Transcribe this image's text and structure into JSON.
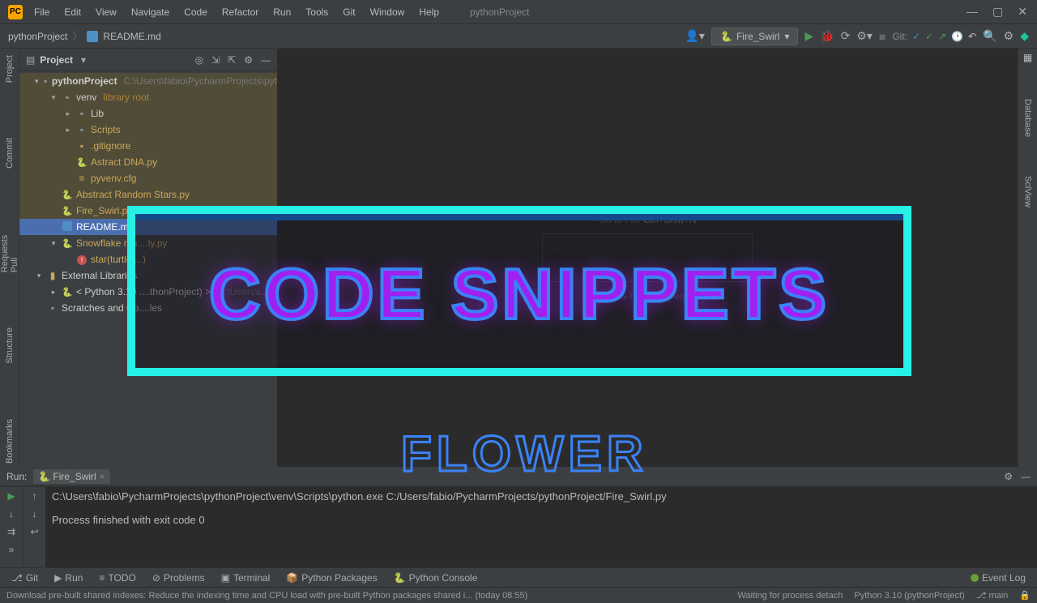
{
  "titlebar": {
    "menus": [
      "File",
      "Edit",
      "View",
      "Navigate",
      "Code",
      "Refactor",
      "Run",
      "Tools",
      "Git",
      "Window",
      "Help"
    ],
    "project": "pythonProject"
  },
  "winctrl": {
    "min": "—",
    "max": "▢",
    "close": "✕"
  },
  "breadcrumb": {
    "project": "pythonProject",
    "file": "README.md"
  },
  "toolbar": {
    "config": "Fire_Swirl",
    "git_label": "Git:"
  },
  "sidebar": {
    "title": "Project",
    "rootName": "pythonProject",
    "rootPath": "C:\\Users\\fabio\\PycharmProjects\\pyt",
    "venv": "venv",
    "venvHint": "library root",
    "lib": "Lib",
    "scripts": "Scripts",
    "gitignore": ".gitignore",
    "astract": "Astract DNA.py",
    "pyvenv": "pyvenv.cfg",
    "abstractStars": "Abstract Random Stars.py",
    "fireswirl": "Fire_Swirl.py",
    "readme": "README.md",
    "snowflake": "Snowflake mu....ly.py",
    "star": "star(turtle....)",
    "extlib": "External Libraries",
    "python310": "< Python 3.10 ....thonProject) >",
    "python310Path": "C:\\Users\\i...",
    "scratches": "Scratches and Co....les"
  },
  "editor": {
    "goto": "Go to File",
    "shortcut": "Ctrl+Shift+N",
    "drop": "Drop files here to open them"
  },
  "run": {
    "label": "Run:",
    "tab": "Fire_Swirl",
    "cmd": "C:\\Users\\fabio\\PycharmProjects\\pythonProject\\venv\\Scripts\\python.exe C:/Users/fabio/PycharmProjects/pythonProject/Fire_Swirl.py",
    "exit": "Process finished with exit code 0"
  },
  "bottom": {
    "git": "Git",
    "run": "Run",
    "todo": "TODO",
    "problems": "Problems",
    "terminal": "Terminal",
    "packages": "Python Packages",
    "console": "Python Console",
    "eventlog": "Event Log"
  },
  "status": {
    "left": "Download pre-built shared indexes: Reduce the indexing time and CPU load with pre-built Python packages shared i... (today 08:55)",
    "wait": "Waiting for process detach",
    "interp": "Python 3.10 (pythonProject)",
    "branch": "main"
  },
  "leftTabs": {
    "project": "Project",
    "commit": "Commit",
    "pull": "Pull Requests",
    "structure": "Structure",
    "bookmarks": "Bookmarks"
  },
  "rightTabs": {
    "database": "Database",
    "sciview": "SciView"
  },
  "overlay": {
    "title": "CODE SNIPPETS",
    "sub": "FLOWER"
  }
}
